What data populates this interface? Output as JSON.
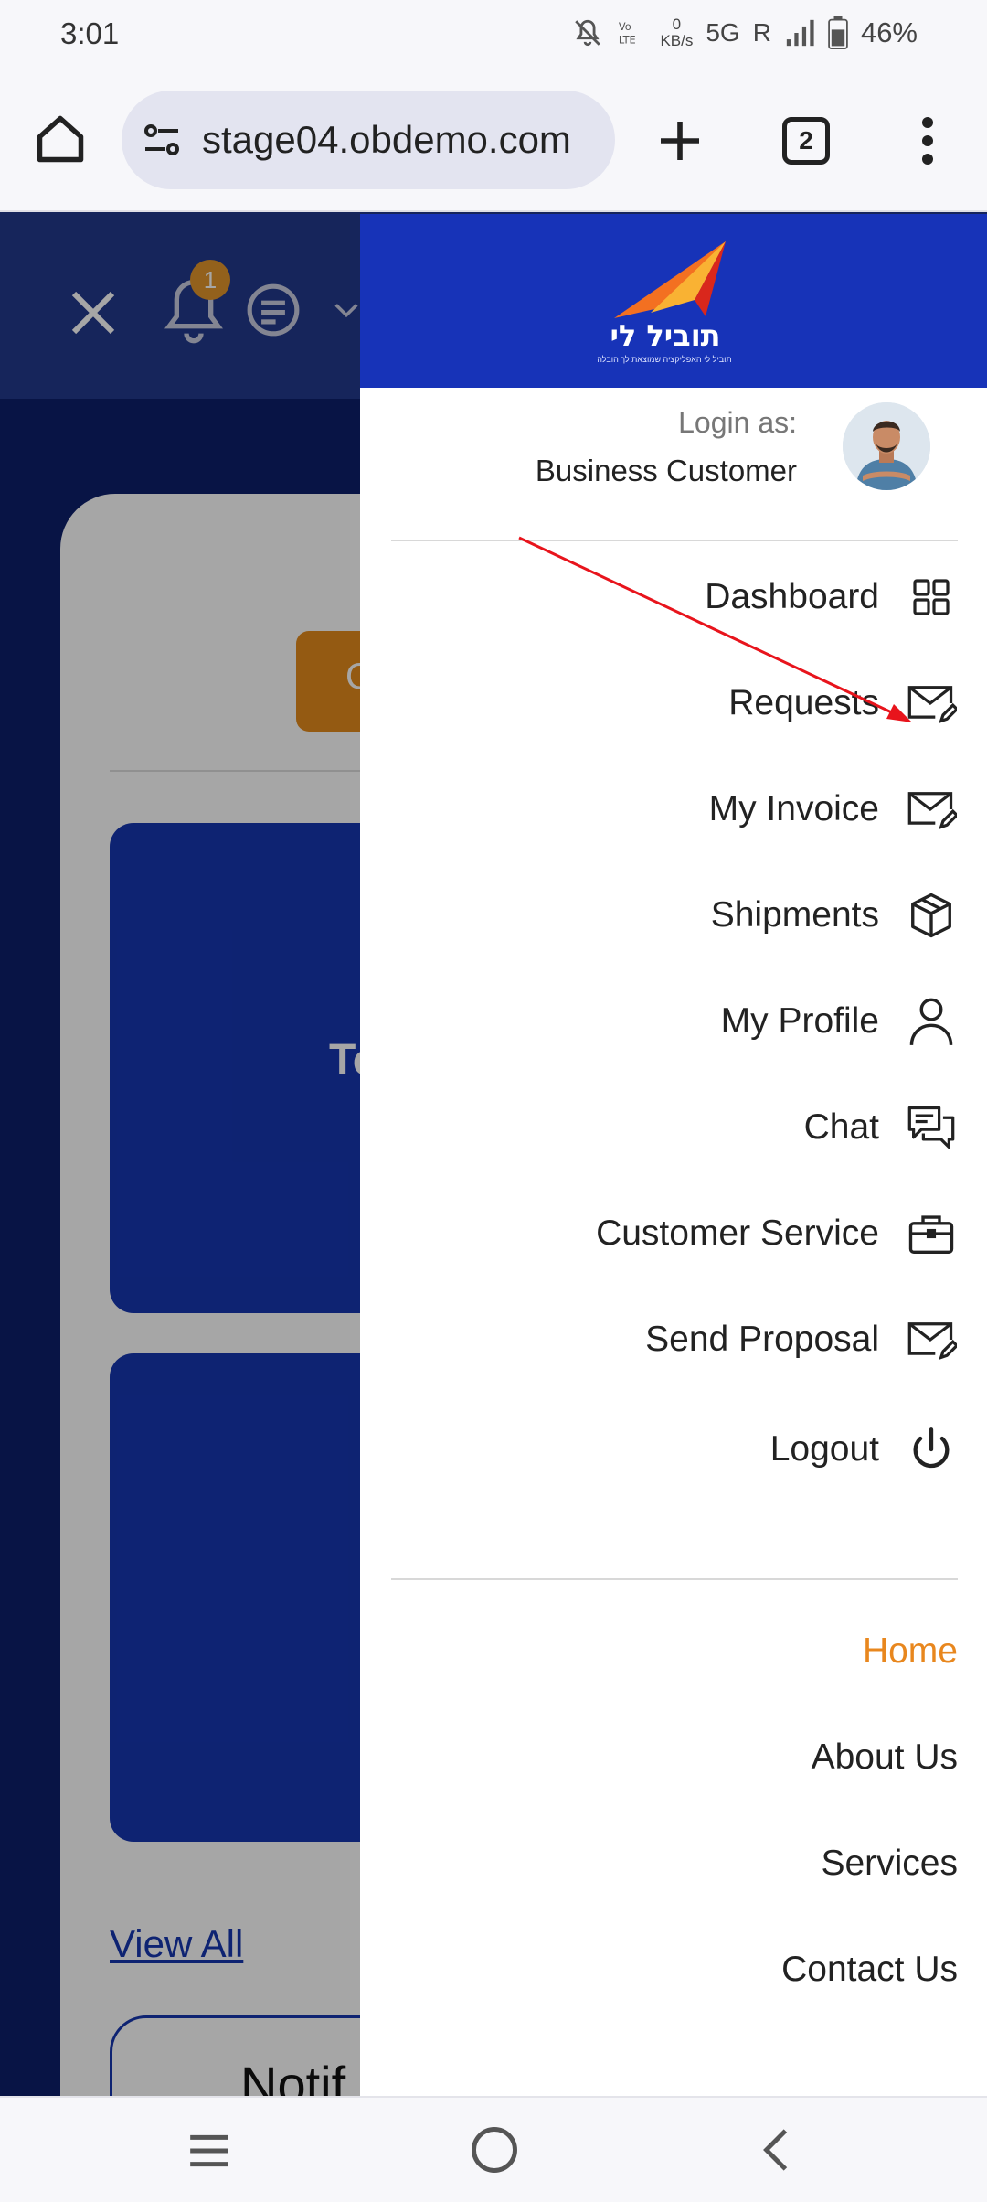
{
  "status_bar": {
    "time": "3:01",
    "net_top": "0",
    "net_unit": "KB/s",
    "network": "5G",
    "roaming": "R",
    "battery": "46%"
  },
  "browser": {
    "url": "stage04.obdemo.com",
    "tab_count": "2"
  },
  "background_page": {
    "notification_count": "1",
    "orange_button_partial": "C",
    "card_text_partial": "To",
    "view_all": "View All",
    "notif_partial": "Notif"
  },
  "drawer": {
    "logo_text": "תוביל לי",
    "logo_sub": "תוביל לי האפליקציה שמוצאת לך הובלה",
    "login_label": "Login as:",
    "login_name": "Business Customer",
    "menu": [
      {
        "label": "Dashboard",
        "icon": "grid-icon"
      },
      {
        "label": "Requests",
        "icon": "mail-edit-icon"
      },
      {
        "label": "My Invoice",
        "icon": "mail-edit-icon"
      },
      {
        "label": "Shipments",
        "icon": "box-icon"
      },
      {
        "label": "My Profile",
        "icon": "user-icon"
      },
      {
        "label": "Chat",
        "icon": "chat-icon"
      },
      {
        "label": "Customer Service",
        "icon": "briefcase-icon"
      },
      {
        "label": "Send Proposal",
        "icon": "mail-edit-icon"
      },
      {
        "label": "Logout",
        "icon": "power-icon"
      }
    ],
    "nav": [
      {
        "label": "Home",
        "active": true
      },
      {
        "label": "About Us",
        "active": false
      },
      {
        "label": "Services",
        "active": false
      },
      {
        "label": "Contact Us",
        "active": false
      }
    ]
  },
  "colors": {
    "drawer_header": "#1733b8",
    "active_nav": "#e8871e",
    "annotation_arrow": "#e8141c"
  }
}
